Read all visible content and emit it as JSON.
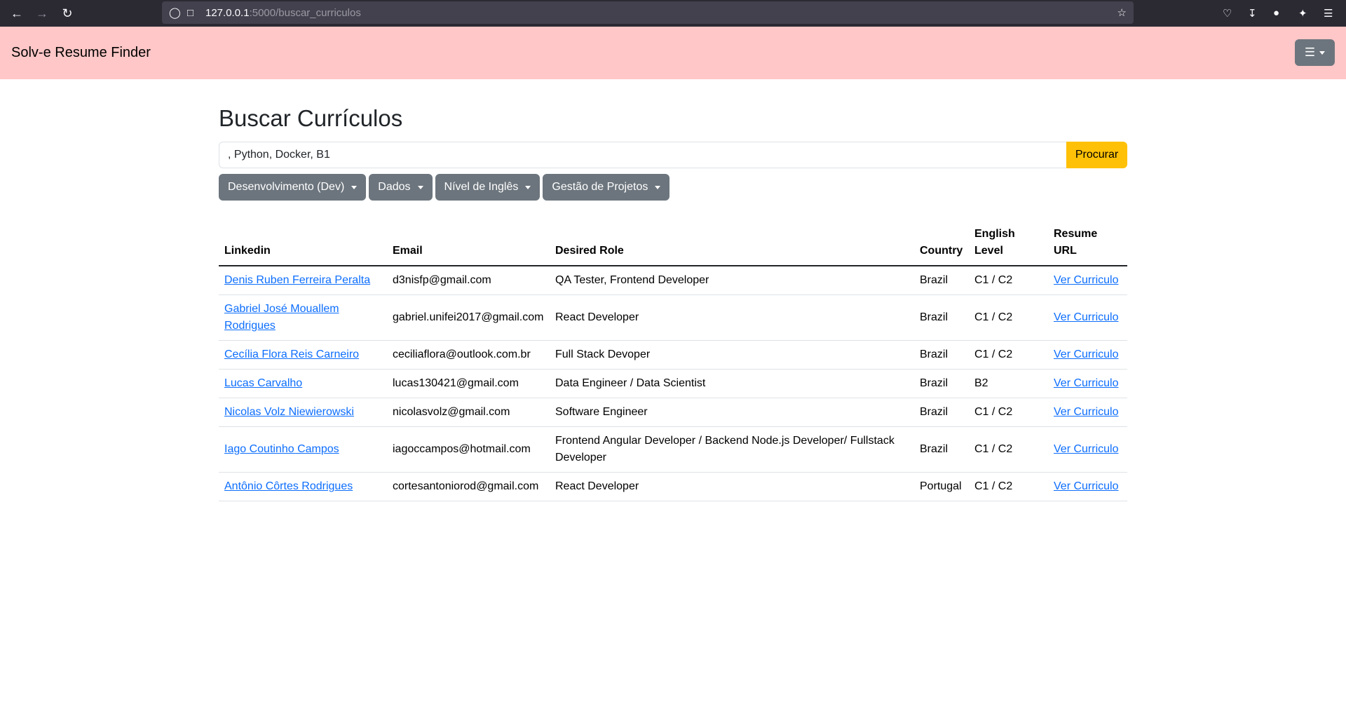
{
  "browser": {
    "url_host": "127.0.0.1",
    "url_path": ":5000/buscar_curriculos"
  },
  "header": {
    "brand": "Solv-e Resume Finder",
    "menu_icon": "hamburger-icon"
  },
  "page": {
    "title": "Buscar Currículos"
  },
  "search": {
    "value": ", Python, Docker, B1",
    "button_label": "Procurar"
  },
  "filters": [
    {
      "label": "Desenvolvimento (Dev)"
    },
    {
      "label": "Dados"
    },
    {
      "label": "Nível de Inglês"
    },
    {
      "label": "Gestão de Projetos"
    }
  ],
  "table": {
    "headers": {
      "linkedin": "Linkedin",
      "email": "Email",
      "role": "Desired Role",
      "country": "Country",
      "english": "English Level",
      "resume": "Resume URL"
    },
    "rows": [
      {
        "linkedin": "Denis Ruben Ferreira Peralta",
        "email": "d3nisfp@gmail.com",
        "role": "QA Tester, Frontend Developer",
        "country": "Brazil",
        "english": "C1 / C2",
        "resume": "Ver Curriculo"
      },
      {
        "linkedin": "Gabriel José Mouallem Rodrigues",
        "email": "gabriel.unifei2017@gmail.com",
        "role": "React Developer",
        "country": "Brazil",
        "english": "C1 / C2",
        "resume": "Ver Curriculo"
      },
      {
        "linkedin": "Cecília Flora Reis Carneiro",
        "email": "ceciliaflora@outlook.com.br",
        "role": "Full Stack Devoper",
        "country": "Brazil",
        "english": "C1 / C2",
        "resume": "Ver Curriculo"
      },
      {
        "linkedin": "Lucas Carvalho",
        "email": "lucas130421@gmail.com",
        "role": "Data Engineer / Data Scientist",
        "country": "Brazil",
        "english": "B2",
        "resume": "Ver Curriculo"
      },
      {
        "linkedin": "Nicolas Volz Niewierowski",
        "email": "nicolasvolz@gmail.com",
        "role": "Software Engineer",
        "country": "Brazil",
        "english": "C1 / C2",
        "resume": "Ver Curriculo"
      },
      {
        "linkedin": "Iago Coutinho Campos",
        "email": "iagoccampos@hotmail.com",
        "role": "Frontend Angular Developer / Backend Node.js Developer/ Fullstack Developer",
        "country": "Brazil",
        "english": "C1 / C2",
        "resume": "Ver Curriculo"
      },
      {
        "linkedin": "Antônio Côrtes Rodrigues",
        "email": "cortesantoniorod@gmail.com",
        "role": "React Developer",
        "country": "Portugal",
        "english": "C1 / C2",
        "resume": "Ver Curriculo"
      }
    ]
  },
  "colors": {
    "header_bg": "#ffc7c7",
    "accent_button": "#ffc107",
    "secondary_button": "#6c757d",
    "link": "#0d6efd"
  }
}
